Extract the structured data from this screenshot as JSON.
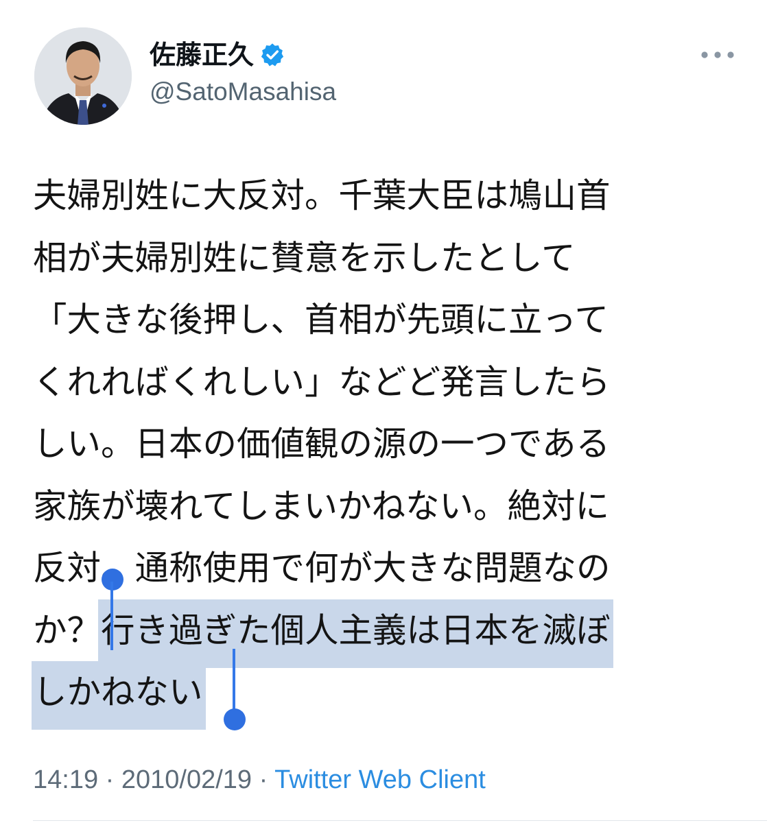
{
  "author": {
    "display_name": "佐藤正久",
    "handle": "@SatoMasahisa",
    "verified_icon": "verified-badge-icon",
    "avatar_icon": "profile-photo"
  },
  "more_icon": "more-options-icon",
  "tweet": {
    "lines": [
      "夫婦別姓に大反対。千葉大臣は鳩山首",
      "相が夫婦別姓に賛意を示したとして",
      "「大きな後押し、首相が先頭に立って",
      "くれればくれしい」などど発言したら",
      "しい。日本の価値観の源の一つである",
      "家族が壊れてしまいかねない。絶対に",
      "反対。通称使用で何が大きな問題なの"
    ],
    "line8_plain": "か？",
    "line8_selected": "行き過ぎた個人主義は日本を滅ぼ",
    "line9_selected": "しかねない"
  },
  "meta": {
    "time": "14:19",
    "separator": " · ",
    "date": "2010/02/19",
    "client": "Twitter Web Client"
  },
  "colors": {
    "link": "#2b8de1",
    "selection": "#c9d7ea",
    "selection_handle": "#2f6fe0",
    "verified": "#1d9bf0"
  }
}
